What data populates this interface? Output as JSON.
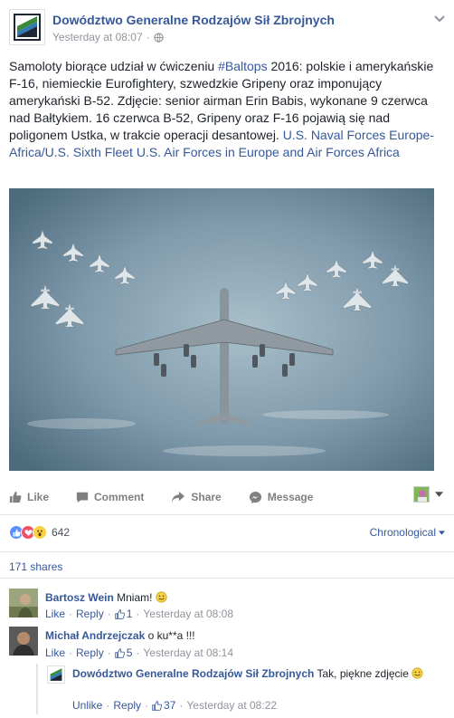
{
  "post": {
    "page_name": "Dowództwo Generalne Rodzajów Sił Zbrojnych",
    "timestamp": "Yesterday at 08:07",
    "privacy_icon": "globe-icon",
    "text_plain_1": "Samoloty biorące udział w ćwiczeniu ",
    "hashtag": "#Baltops",
    "text_plain_2": " 2016: polskie i amerykańskie F-16, niemieckie Eurofightery, szwedzkie Gripeny oraz imponujący amerykański B-52. Zdjęcie: senior airman Erin Babis, wykonane 9 czerwca nad Bałtykiem. 16 czerwca B-52, Gripeny oraz F-16 pojawią się nad poligonem Ustka, w trakcie operacji desantowej. ",
    "tag_1": "U.S. Naval Forces Europe-Africa/U.S. Sixth Fleet",
    "tag_2": "U.S. Air Forces in Europe and Air Forces Africa"
  },
  "actions": {
    "like": "Like",
    "comment": "Comment",
    "share": "Share",
    "message": "Message"
  },
  "reactions": {
    "count": "642",
    "types": [
      "like",
      "love",
      "wow"
    ],
    "order_label": "Chronological"
  },
  "shares_label": "171 shares",
  "comments": [
    {
      "author": "Bartosz Wein",
      "text": "Mniam!",
      "emoji": "smile",
      "like_label": "Like",
      "reply_label": "Reply",
      "likes": "1",
      "time": "Yesterday at 08:08"
    },
    {
      "author": "Michał Andrzejczak",
      "text": "o ku**a !!!",
      "like_label": "Like",
      "reply_label": "Reply",
      "likes": "5",
      "time": "Yesterday at 08:14"
    }
  ],
  "reply": {
    "author": "Dowództwo Generalne Rodzajów Sił Zbrojnych",
    "text": "Tak, piękne zdjęcie",
    "emoji": "smile",
    "like_label": "Unlike",
    "reply_label": "Reply",
    "likes": "37",
    "time": "Yesterday at 08:22"
  },
  "colors": {
    "link": "#365899",
    "meta": "#90949c",
    "like_blue": "#5890ff",
    "love_red": "#f25268",
    "wow_yellow": "#fcd140"
  }
}
